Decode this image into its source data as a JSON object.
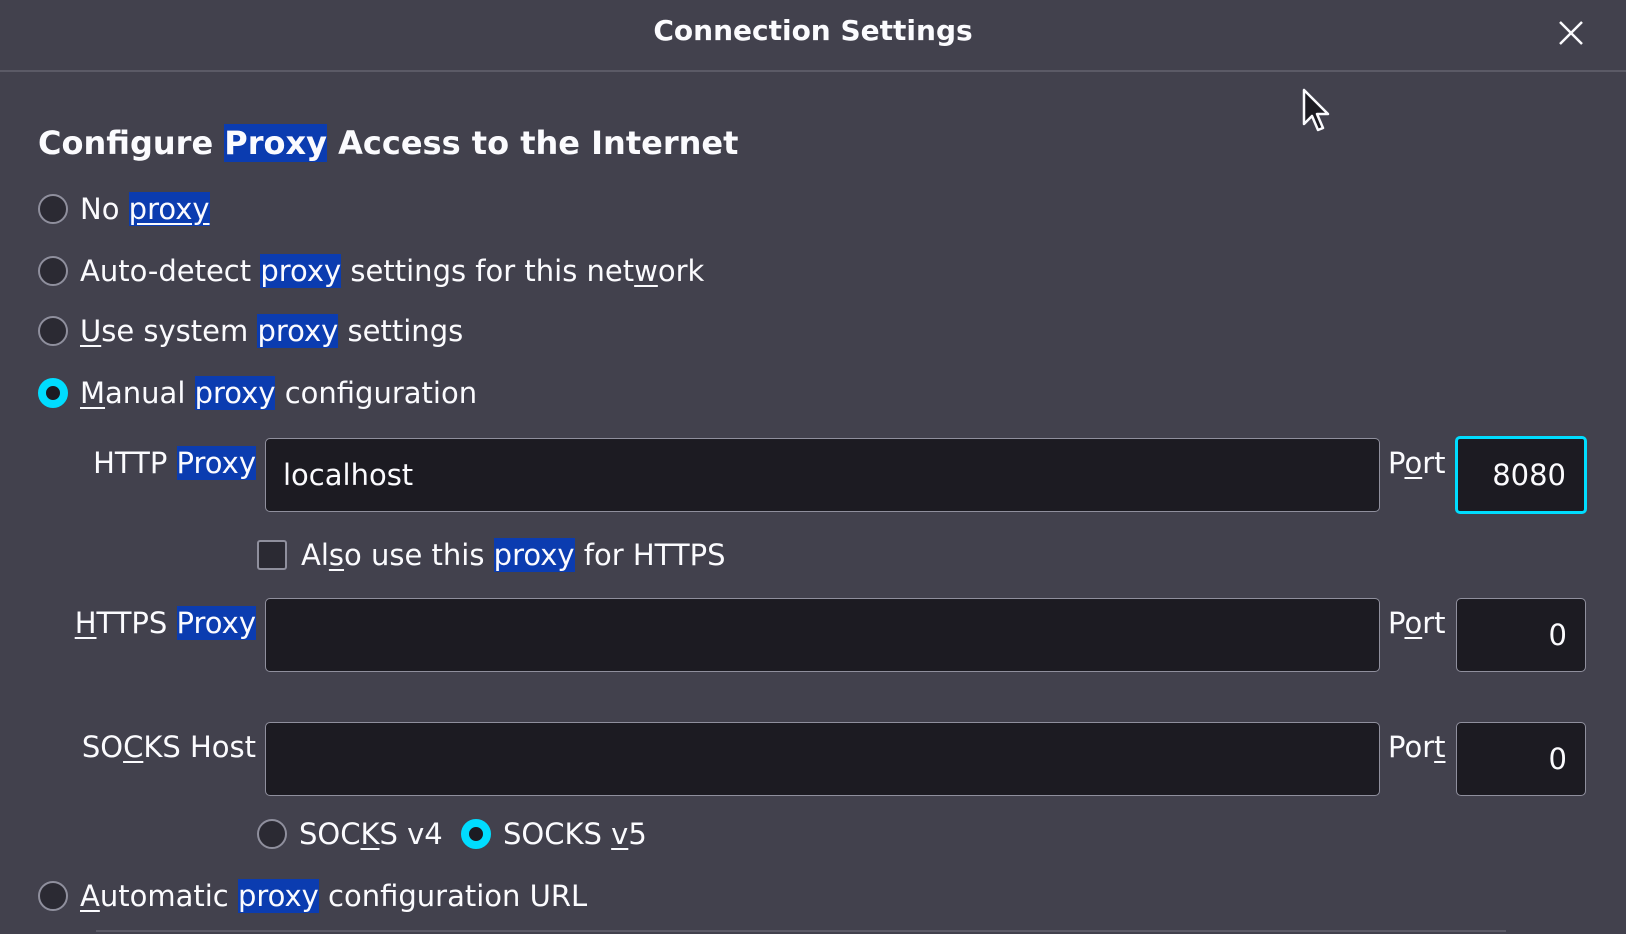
{
  "dialog": {
    "title": "Connection Settings"
  },
  "heading": {
    "pre": "Configure ",
    "highlight": "Proxy",
    "post": " Access to the Internet"
  },
  "proxy_options": {
    "no_proxy": {
      "pre": "No ",
      "highlight": "proxy",
      "post": "",
      "checked": false
    },
    "auto_detect": {
      "pre": "Auto-detect ",
      "highlight": "proxy",
      "post_a": " settings for this net",
      "post_u": "w",
      "post_b": "ork",
      "checked": false
    },
    "system": {
      "pre_u": "U",
      "pre": "se system ",
      "highlight": "proxy",
      "post": " settings",
      "checked": false
    },
    "manual": {
      "pre_u": "M",
      "pre": "anual ",
      "highlight": "proxy",
      "post": " configuration",
      "checked": true
    },
    "automatic_url": {
      "pre_u": "A",
      "pre": "utomatic ",
      "highlight": "proxy",
      "post": " configuration URL",
      "checked": false
    }
  },
  "http": {
    "label_pre": "HTTP ",
    "label_highlight": "Proxy",
    "value": "localhost",
    "port_label_a": "P",
    "port_label_u": "o",
    "port_label_b": "rt",
    "port_value": "8080"
  },
  "also_https": {
    "pre_a": "Al",
    "pre_u": "s",
    "pre_b": "o use this ",
    "highlight": "proxy",
    "post": " for HTTPS",
    "checked": false
  },
  "https": {
    "label_u": "H",
    "label_pre": "TTPS ",
    "label_highlight": "Proxy",
    "value": "",
    "port_label_a": "P",
    "port_label_u": "o",
    "port_label_b": "rt",
    "port_value": "0"
  },
  "socks": {
    "label_a": "SO",
    "label_u": "C",
    "label_b": "KS Host",
    "value": "",
    "port_label_a": "Por",
    "port_label_u": "t",
    "port_value": "0",
    "v4_a": "SOC",
    "v4_u": "K",
    "v4_b": "S v4",
    "v4_checked": false,
    "v5_a": "SOCKS ",
    "v5_u": "v",
    "v5_b": "5",
    "v5_checked": true
  },
  "colors": {
    "background": "#42414d",
    "accent": "#00ddff",
    "highlight": "#0b3cb0",
    "input_bg": "#1c1b22"
  }
}
